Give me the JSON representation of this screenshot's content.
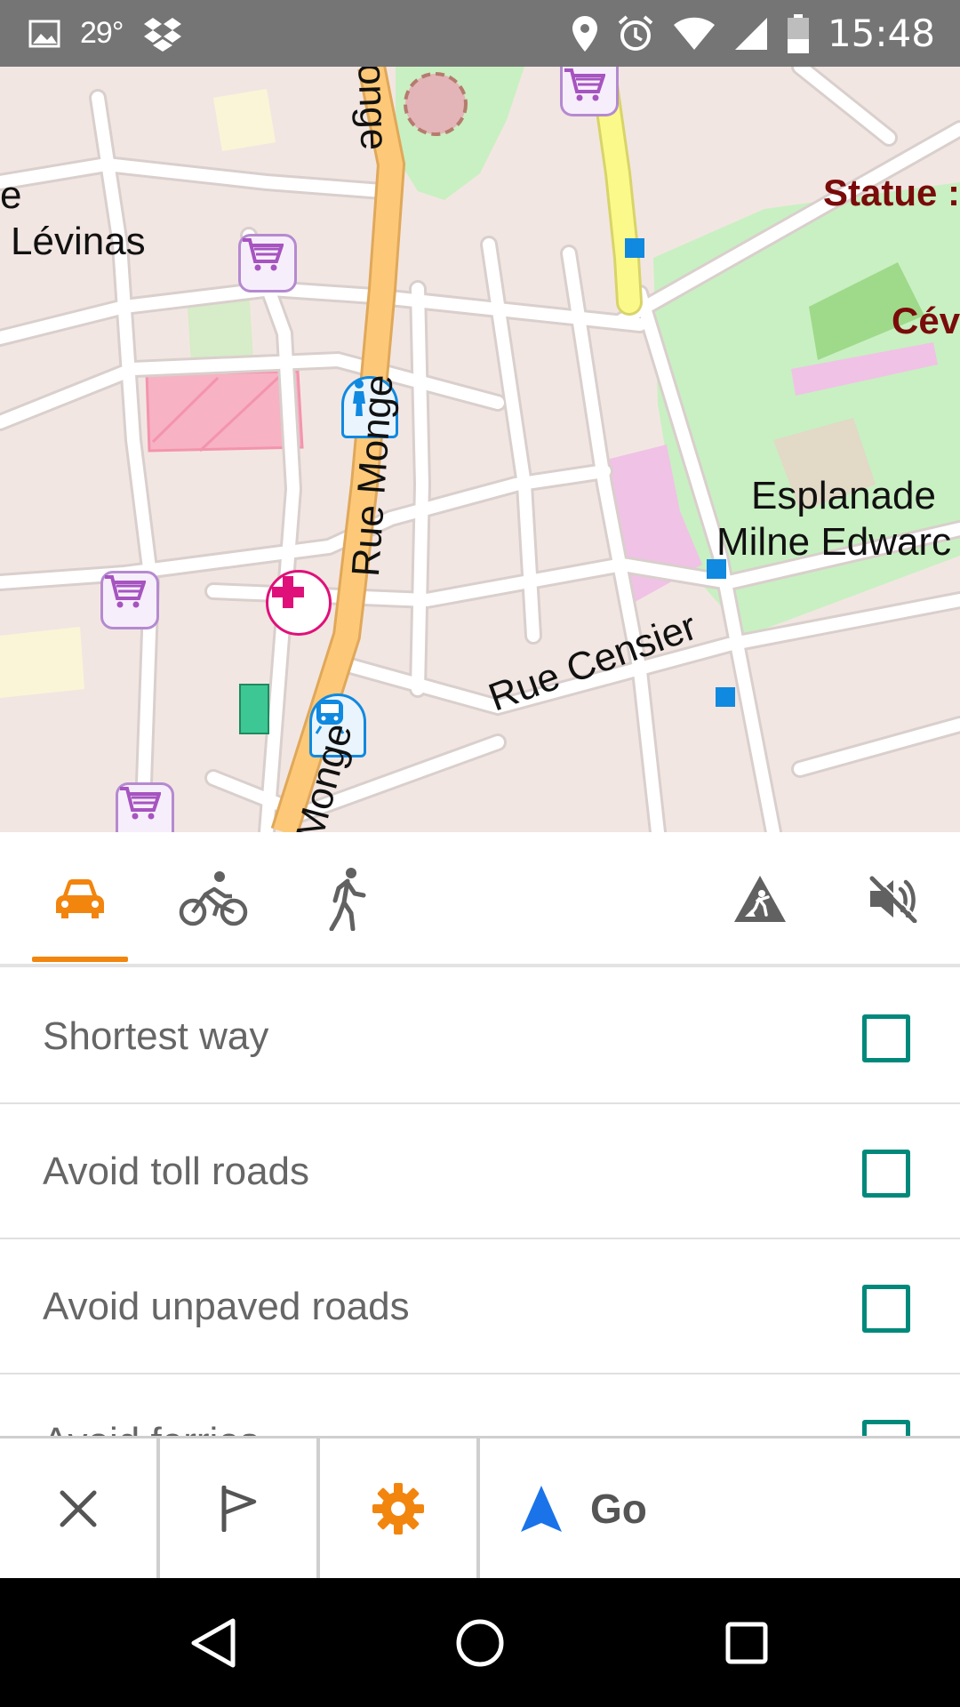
{
  "status_bar": {
    "temperature": "29°",
    "time": "15:48",
    "icons": [
      "image-icon",
      "dropbox-icon",
      "location-pin-icon",
      "alarm-icon",
      "wifi-icon",
      "signal-icon",
      "battery-icon"
    ]
  },
  "map": {
    "labels": {
      "levinas_prefix": "e",
      "levinas": "Lévinas",
      "statue": "Statue :",
      "cev": "Cév",
      "esplanade_1": "Esplanade",
      "esplanade_2": "Milne Edwarc",
      "rue_monge": "Rue Monge",
      "rue_monge_top": "onge",
      "rue_monge_bottom": "Monge",
      "rue_censier": "Rue Censier"
    },
    "colors": {
      "background": "#f2e6e2",
      "park": "#c9f0c2",
      "main_road": "#fdc978",
      "secondary_road": "#fbf98a",
      "shop": "#a654c0",
      "pharmacy": "#e0107a",
      "stop": "#1089e0"
    },
    "poi_icons": [
      "shop-cart-icon",
      "pharmacy-icon",
      "bus-stop-icon",
      "subway-station-icon"
    ]
  },
  "modes": {
    "tabs": [
      {
        "name": "car",
        "icon": "car-icon",
        "selected": true
      },
      {
        "name": "bicycle",
        "icon": "bicycle-icon",
        "selected": false
      },
      {
        "name": "pedestrian",
        "icon": "pedestrian-icon",
        "selected": false
      }
    ],
    "actions": [
      {
        "icon": "road-works-icon"
      },
      {
        "icon": "volume-off-icon"
      }
    ],
    "accent": "#f2850d"
  },
  "options": [
    {
      "label": "Shortest way",
      "checked": false
    },
    {
      "label": "Avoid toll roads",
      "checked": false
    },
    {
      "label": "Avoid unpaved roads",
      "checked": false
    },
    {
      "label": "Avoid ferries",
      "checked": false
    }
  ],
  "bottom_bar": {
    "close_icon": "close-icon",
    "flag_icon": "flag-icon",
    "settings_icon": "gear-icon",
    "go_label": "Go",
    "go_icon": "navigation-arrow-icon",
    "settings_color": "#f2850d",
    "go_color": "#1a73e8"
  },
  "nav_bar": {
    "icons": [
      "back-icon",
      "home-icon",
      "recents-icon"
    ]
  }
}
